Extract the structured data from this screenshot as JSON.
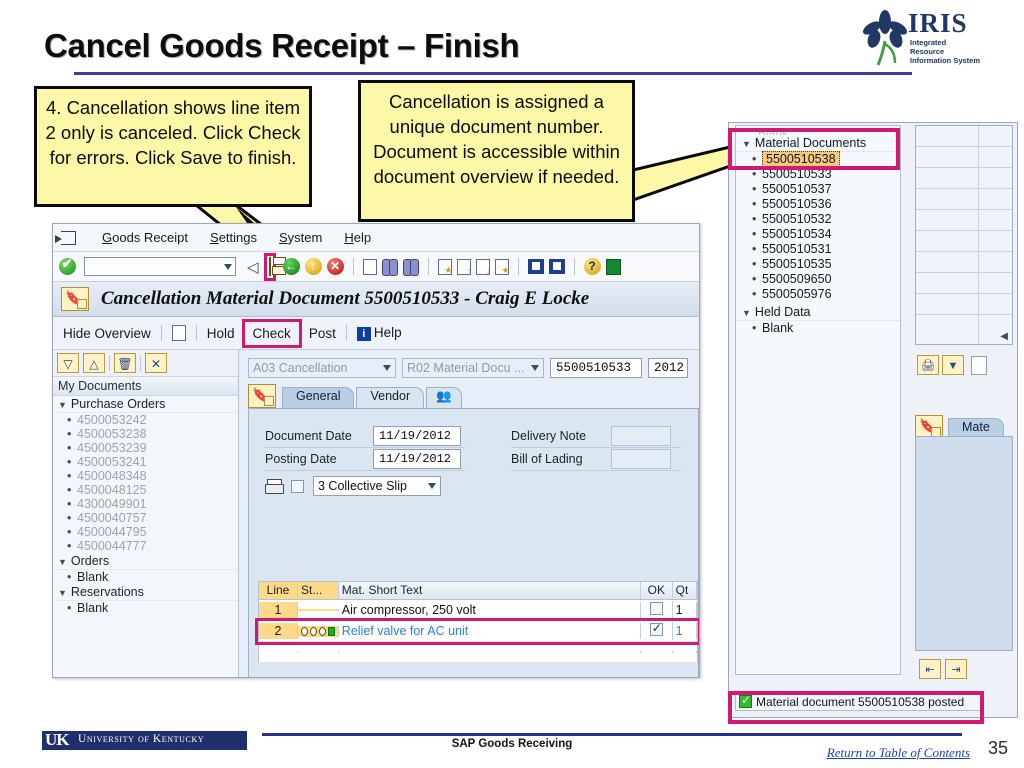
{
  "slide": {
    "title": "Cancel Goods Receipt – Finish",
    "page_number": "35",
    "footer_center": "SAP Goods Receiving",
    "footer_link": "Return to Table of Contents",
    "uk_logo_mark": "UK",
    "uk_logo_text": "University of Kentucky"
  },
  "logo": {
    "word": "IRIS",
    "sub_line1": "Integrated Resource",
    "sub_line2": "Information System"
  },
  "callouts": {
    "left": "4. Cancellation shows line item 2 only is canceled. Click Check for errors. Click Save to finish.",
    "right": "Cancellation is assigned a unique document number. Document is accessible within document overview if needed."
  },
  "sap": {
    "menu": [
      {
        "label": "Goods Receipt",
        "accel": "G"
      },
      {
        "label": "Settings",
        "accel": "S"
      },
      {
        "label": "System",
        "accel": "S"
      },
      {
        "label": "Help",
        "accel": "H"
      }
    ],
    "command_field_value": "",
    "toolbar_icons": [
      "enter-check-icon",
      "command-field",
      "back-arrow-icon",
      "save-icon",
      "exit-green-icon",
      "back-yellow-icon",
      "cancel-red-icon",
      "print-icon",
      "find-icon",
      "find-next-icon",
      "first-page-icon",
      "previous-page-icon",
      "next-page-icon",
      "last-page-icon",
      "new-session-icon",
      "create-shortcut-icon",
      "help-icon",
      "layout-menu-icon"
    ],
    "document_title": "Cancellation Material Document 5500510533 - Craig E Locke",
    "actions": {
      "hide_overview": "Hide Overview",
      "new_doc_icon": "new-document-icon",
      "hold": "Hold",
      "check": "Check",
      "post": "Post",
      "help": "Help"
    },
    "tree": {
      "toolbar": [
        "expand-all-icon",
        "collapse-all-icon",
        "delete-icon",
        "close-icon"
      ],
      "header": "My Documents",
      "groups": [
        {
          "label": "Purchase Orders",
          "items": [
            "4500053242",
            "4500053238",
            "4500053239",
            "4500053241",
            "4500048348",
            "4500048125",
            "4300049901",
            "4500040757",
            "4500044795",
            "4500044777"
          ]
        },
        {
          "label": "Orders",
          "items": [
            "Blank"
          ]
        },
        {
          "label": "Reservations",
          "items": [
            "Blank"
          ]
        }
      ]
    },
    "form": {
      "movement_type": "A03 Cancellation",
      "reference_doc": "R02 Material Docu ...",
      "doc_number": "5500510533",
      "doc_year": "2012",
      "tabs": [
        {
          "label": "General",
          "active": true
        },
        {
          "label": "Vendor",
          "active": false
        },
        {
          "label": "partner-icon",
          "active": false
        }
      ],
      "fields": [
        {
          "label": "Document Date",
          "value": "11/19/2012"
        },
        {
          "label": "Posting Date",
          "value": "11/19/2012"
        },
        {
          "label": "Delivery Note",
          "value": ""
        },
        {
          "label": "Bill of Lading",
          "value": ""
        }
      ],
      "print_checkbox_checked": false,
      "print_version": "3 Collective Slip"
    },
    "grid": {
      "columns": [
        "Line",
        "St...",
        "Mat. Short Text",
        "OK",
        "Qt"
      ],
      "rows": [
        {
          "line": "1",
          "status": "",
          "text": "Air compressor, 250 volt",
          "ok": false,
          "qty": "1",
          "highlighted": false
        },
        {
          "line": "2",
          "status": "lights",
          "text": "Relief valve for AC unit",
          "ok": true,
          "qty": "1",
          "highlighted": true
        }
      ]
    }
  },
  "right_panel": {
    "tree": {
      "groups": [
        {
          "label": "Material Documents",
          "items": [
            "5500510538",
            "5500510533",
            "5500510537",
            "5500510536",
            "5500510532",
            "5500510534",
            "5500510531",
            "5500510535",
            "5500509650",
            "5500505976"
          ],
          "selected_index": 0
        },
        {
          "label": "Held Data",
          "items": [
            "Blank"
          ]
        }
      ]
    },
    "toolbar_icons": [
      "print-icon",
      "filter-icon"
    ],
    "tab_label": "Mate",
    "bottom_icons": [
      "import-icon",
      "export-icon"
    ],
    "status_message": "Material document 5500510538 posted"
  }
}
